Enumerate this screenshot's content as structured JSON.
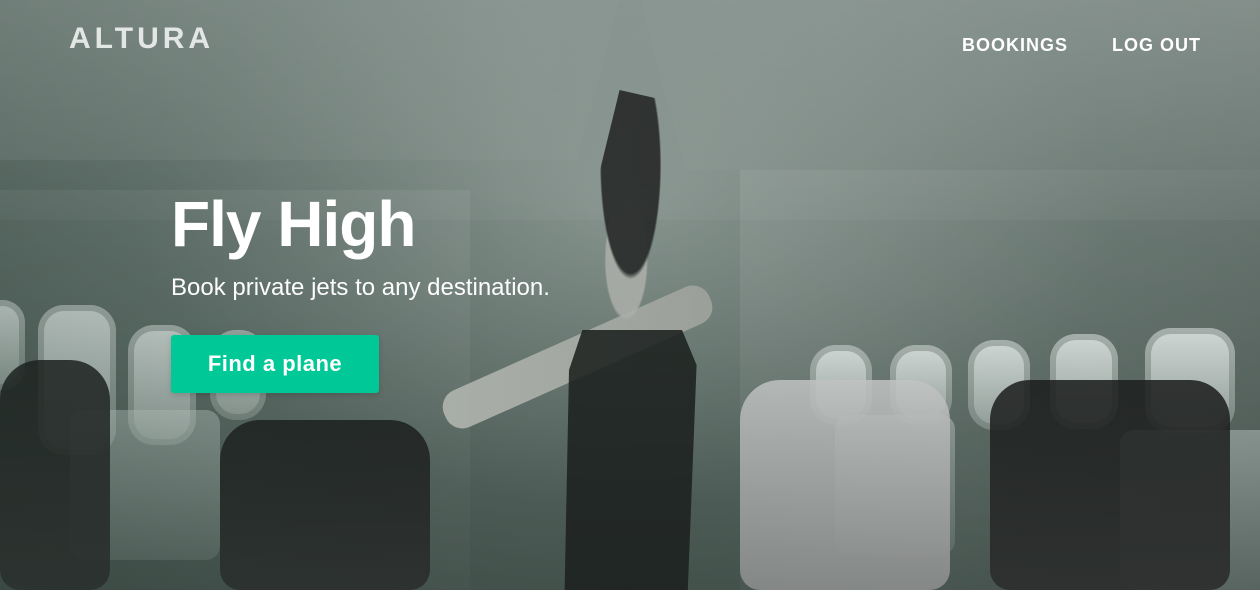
{
  "brand": {
    "name": "ALTURA"
  },
  "nav": {
    "items": [
      {
        "label": "BOOKINGS"
      },
      {
        "label": "LOG OUT"
      }
    ]
  },
  "hero": {
    "title": "Fly High",
    "subtitle": "Book private jets to any destination.",
    "cta_label": "Find a plane",
    "accent_color": "#00C896"
  },
  "background": {
    "icon_name": "airplane-cabin-background-image"
  }
}
